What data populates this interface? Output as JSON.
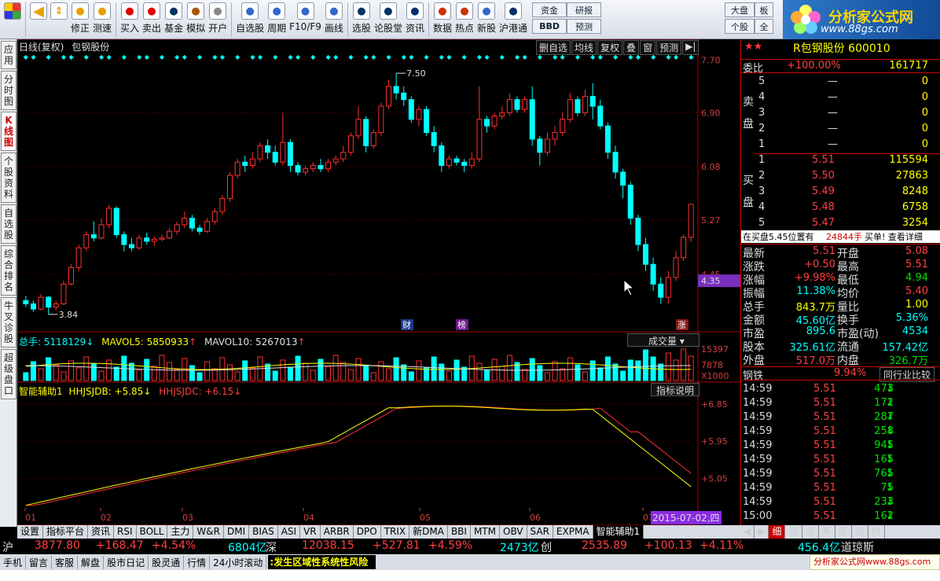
{
  "toolbar": {
    "buttons": [
      "修正",
      "测速",
      "买入",
      "卖出",
      "基金",
      "模拟",
      "开户",
      "自选股",
      "周期",
      "F10/F9",
      "画线",
      "选股",
      "论股堂",
      "资讯",
      "数据",
      "热点",
      "新股",
      "沪港通"
    ],
    "mini": [
      "资金",
      "研报",
      "BBD",
      "预测",
      "大盘",
      "板",
      "个股",
      "全"
    ]
  },
  "logo": {
    "title": "分析家公式网",
    "url": "www.88gs.com"
  },
  "left_tabs": [
    "应用",
    "分时图",
    "K线图",
    "个股资料",
    "自选股",
    "综合排名",
    "牛叉诊股",
    "超级盘口"
  ],
  "chart_header": {
    "title": "日线(复权)",
    "stock": "包钢股份",
    "buttons": [
      "删自选",
      "均线",
      "复权",
      "叠",
      "窗",
      "预测"
    ]
  },
  "price_axis": [
    "7.70",
    "6.90",
    "6.08",
    "5.27",
    "4.45"
  ],
  "current_price_tag": "4.35",
  "annotations": {
    "high": "7.50",
    "low": "3.84",
    "marks": [
      "财",
      "榜",
      "涨"
    ]
  },
  "volume": {
    "label": "总手: 5118129",
    "mavol5": "MAVOL5: 5850933",
    "mavol10": "MAVOL10: 5267013",
    "dropdown": "成交量",
    "axis": [
      "15397",
      "7878",
      "X1000"
    ]
  },
  "indicator": {
    "label": "智能辅助1",
    "jdb": "HHJSJDB: +5.85",
    "jdc": "HHJSJDC: +6.15",
    "btn": "指标说明",
    "axis": [
      "+6.85",
      "+5.95",
      "+5.05"
    ]
  },
  "time_axis": [
    "01",
    "02",
    "03",
    "04",
    "05",
    "06",
    "07"
  ],
  "date_tag": "2015-07-02,四",
  "bottom_tabs": [
    "设置",
    "指标平台",
    "资讯",
    "RSI",
    "BOLL",
    "主力",
    "W&R",
    "DMI",
    "BIAS",
    "ASI",
    "VR",
    "ARBR",
    "DPO",
    "TRIX",
    "新DMA",
    "BBI",
    "MTM",
    "OBV",
    "SAR",
    "EXPMA",
    "智能辅助1"
  ],
  "right_tabs": [
    "细",
    "诊",
    "分",
    "筹",
    "股",
    "指",
    "财"
  ],
  "quote": {
    "header": "R包钢股份 600010",
    "weibi_label": "委比",
    "weibi": "+100.00%",
    "weibi_vol": "161717",
    "sell": [
      [
        "5",
        "—",
        "0"
      ],
      [
        "4",
        "—",
        "0"
      ],
      [
        "3",
        "—",
        "0"
      ],
      [
        "2",
        "—",
        "0"
      ],
      [
        "1",
        "—",
        "0"
      ]
    ],
    "buy": [
      [
        "1",
        "5.51",
        "115594"
      ],
      [
        "2",
        "5.50",
        "27863"
      ],
      [
        "3",
        "5.49",
        "8248"
      ],
      [
        "4",
        "5.48",
        "6758"
      ],
      [
        "5",
        "5.47",
        "3254"
      ]
    ],
    "sell_label": "卖盘",
    "buy_label": "买盘",
    "notice": "在买盘5.45位置有",
    "notice_vol": "24844手",
    "notice_end": "买单! 查看详细",
    "stats": [
      [
        "最新",
        "5.51",
        "开盘",
        "5.08"
      ],
      [
        "涨跌",
        "+0.50",
        "最高",
        "5.51"
      ],
      [
        "涨幅",
        "+9.98%",
        "最低",
        "4.94"
      ],
      [
        "振幅",
        "11.38%",
        "均价",
        "5.40"
      ],
      [
        "总手",
        "843.7万",
        "量比",
        "1.00"
      ],
      [
        "金额",
        "45.60亿",
        "换手",
        "5.36%"
      ],
      [
        "市盈",
        "895.6",
        "市盈(动)",
        "4534"
      ],
      [
        "股本",
        "325.61亿",
        "流通",
        "157.42亿"
      ],
      [
        "外盘",
        "517.0万",
        "内盘",
        "326.7万"
      ]
    ],
    "industry": "钢铁",
    "industry_pct": "9.94%",
    "industry_btn": "同行业比较",
    "ticks": [
      [
        "14:59",
        "5.51",
        "473"
      ],
      [
        "14:59",
        "5.51",
        "172"
      ],
      [
        "14:59",
        "5.51",
        "287"
      ],
      [
        "14:59",
        "5.51",
        "258"
      ],
      [
        "14:59",
        "5.51",
        "945"
      ],
      [
        "14:59",
        "5.51",
        "165"
      ],
      [
        "14:59",
        "5.51",
        "765"
      ],
      [
        "14:59",
        "5.51",
        "75"
      ],
      [
        "14:59",
        "5.51",
        "233"
      ],
      [
        "15:00",
        "5.51",
        "162"
      ]
    ]
  },
  "indexbar": {
    "sh_label": "沪",
    "sh": "3877.80",
    "sh_chg": "+168.47",
    "sh_pct": "+4.54%",
    "sh_amt": "6804亿",
    "sz_label": "深",
    "sz": "12038.15",
    "sz_chg": "+527.81",
    "sz_pct": "+4.59%",
    "sz_amt": "2473亿",
    "cy_label": "创",
    "cy": "2535.89",
    "cy_chg": "+100.13",
    "cy_pct": "+4.11%",
    "cy_amt": "456.4亿",
    "dj_label": "道琼斯"
  },
  "statusbar": [
    "手机",
    "留言",
    "客服",
    "解盘",
    "股市日记",
    "股灵通",
    "行情",
    "24小时滚动"
  ],
  "status_msg": ":发生区域性系统性风险",
  "watermark": "分析家公式网www.88gs.com",
  "colors": {
    "up": "#ff4040",
    "down": "#00ffff",
    "ma_yellow": "#ffff00",
    "ma_red": "#ff3030",
    "accent": "#c00000"
  },
  "chart_data": {
    "type": "candlestick",
    "ylim": [
      3.6,
      7.8
    ],
    "candles": [
      [
        4.05,
        4.0,
        4.12,
        3.95
      ],
      [
        4.0,
        3.92,
        4.05,
        3.88
      ],
      [
        3.92,
        4.1,
        4.15,
        3.9
      ],
      [
        4.1,
        3.95,
        4.12,
        3.84
      ],
      [
        3.95,
        4.0,
        4.05,
        3.9
      ],
      [
        4.0,
        4.3,
        4.35,
        3.98
      ],
      [
        4.3,
        4.55,
        4.6,
        4.28
      ],
      [
        4.55,
        4.85,
        4.9,
        4.5
      ],
      [
        4.85,
        5.05,
        5.1,
        4.8
      ],
      [
        5.05,
        5.0,
        5.25,
        4.95
      ],
      [
        5.0,
        5.2,
        5.3,
        4.98
      ],
      [
        5.2,
        5.45,
        5.5,
        5.15
      ],
      [
        5.45,
        5.05,
        5.48,
        5.0
      ],
      [
        5.05,
        4.9,
        5.1,
        4.8
      ],
      [
        4.9,
        4.85,
        5.0,
        4.8
      ],
      [
        4.85,
        5.0,
        5.05,
        4.82
      ],
      [
        5.0,
        4.95,
        5.08,
        4.9
      ],
      [
        4.95,
        4.98,
        5.02,
        4.88
      ],
      [
        4.98,
        5.0,
        5.05,
        4.95
      ],
      [
        5.0,
        5.1,
        5.15,
        4.98
      ],
      [
        5.1,
        5.2,
        5.25,
        5.05
      ],
      [
        5.2,
        5.3,
        5.4,
        5.15
      ],
      [
        5.3,
        5.15,
        5.35,
        5.1
      ],
      [
        5.15,
        5.1,
        5.2,
        5.05
      ],
      [
        5.1,
        5.25,
        5.3,
        5.08
      ],
      [
        5.25,
        5.4,
        5.45,
        5.2
      ],
      [
        5.4,
        5.6,
        5.65,
        5.35
      ],
      [
        5.6,
        5.95,
        6.0,
        5.55
      ],
      [
        5.95,
        6.15,
        6.2,
        5.9
      ],
      [
        6.15,
        6.1,
        6.25,
        6.0
      ],
      [
        6.1,
        6.2,
        6.3,
        6.05
      ],
      [
        6.2,
        6.4,
        6.45,
        6.15
      ],
      [
        6.4,
        6.3,
        6.5,
        6.2
      ],
      [
        6.3,
        6.15,
        6.4,
        6.1
      ],
      [
        6.15,
        6.45,
        6.9,
        6.1
      ],
      [
        6.45,
        6.1,
        6.5,
        6.0
      ],
      [
        6.1,
        6.0,
        6.15,
        5.95
      ],
      [
        6.0,
        6.05,
        6.1,
        5.95
      ],
      [
        6.05,
        6.1,
        6.15,
        6.0
      ],
      [
        6.1,
        6.05,
        6.2,
        6.0
      ],
      [
        6.05,
        6.15,
        6.2,
        6.0
      ],
      [
        6.15,
        6.2,
        6.25,
        6.1
      ],
      [
        6.2,
        6.3,
        6.4,
        6.15
      ],
      [
        6.3,
        6.55,
        6.6,
        6.25
      ],
      [
        6.55,
        6.8,
        7.0,
        6.5
      ],
      [
        6.8,
        6.4,
        6.85,
        6.3
      ],
      [
        6.4,
        6.6,
        6.65,
        6.35
      ],
      [
        6.6,
        7.0,
        7.05,
        6.55
      ],
      [
        7.0,
        7.3,
        7.4,
        6.95
      ],
      [
        7.3,
        7.2,
        7.5,
        7.1
      ],
      [
        7.2,
        7.1,
        7.3,
        7.0
      ],
      [
        7.1,
        6.8,
        7.15,
        6.75
      ],
      [
        6.8,
        6.95,
        7.0,
        6.7
      ],
      [
        6.95,
        6.6,
        7.0,
        6.55
      ],
      [
        6.6,
        6.4,
        6.7,
        6.3
      ],
      [
        6.4,
        6.1,
        6.45,
        6.0
      ],
      [
        6.1,
        6.2,
        6.25,
        6.05
      ],
      [
        6.2,
        6.15,
        6.25,
        6.1
      ],
      [
        6.15,
        6.1,
        6.2,
        6.0
      ],
      [
        6.1,
        6.2,
        6.3,
        6.05
      ],
      [
        6.2,
        6.8,
        7.3,
        6.15
      ],
      [
        6.8,
        6.7,
        6.85,
        6.6
      ],
      [
        6.7,
        6.85,
        6.9,
        6.65
      ],
      [
        6.85,
        6.9,
        7.0,
        6.8
      ],
      [
        6.9,
        7.1,
        7.2,
        6.85
      ],
      [
        7.1,
        6.95,
        7.15,
        6.9
      ],
      [
        6.95,
        7.1,
        7.15,
        6.9
      ],
      [
        7.1,
        6.5,
        7.3,
        6.4
      ],
      [
        6.5,
        6.3,
        6.55,
        6.1
      ],
      [
        6.3,
        6.5,
        6.6,
        6.25
      ],
      [
        6.5,
        6.6,
        6.7,
        6.4
      ],
      [
        6.6,
        6.8,
        6.9,
        6.55
      ],
      [
        6.8,
        7.1,
        7.2,
        6.75
      ],
      [
        7.1,
        6.9,
        7.15,
        6.85
      ],
      [
        6.9,
        7.15,
        7.25,
        6.85
      ],
      [
        7.15,
        7.0,
        7.35,
        6.8
      ],
      [
        7.0,
        6.7,
        7.1,
        6.65
      ],
      [
        6.7,
        6.3,
        6.75,
        6.2
      ],
      [
        6.3,
        6.0,
        6.4,
        5.9
      ],
      [
        6.0,
        5.8,
        6.05,
        5.6
      ],
      [
        5.8,
        5.3,
        5.85,
        5.2
      ],
      [
        5.3,
        4.9,
        5.35,
        4.8
      ],
      [
        4.9,
        4.6,
        5.0,
        4.5
      ],
      [
        4.6,
        4.3,
        4.7,
        4.2
      ],
      [
        4.3,
        4.1,
        4.4,
        4.0
      ],
      [
        4.1,
        4.4,
        4.5,
        4.0
      ],
      [
        4.4,
        4.7,
        4.8,
        4.35
      ],
      [
        4.7,
        5.01,
        5.05,
        4.65
      ],
      [
        5.01,
        5.51,
        5.51,
        4.94
      ]
    ],
    "high_label": 7.5,
    "low_label": 3.84
  }
}
